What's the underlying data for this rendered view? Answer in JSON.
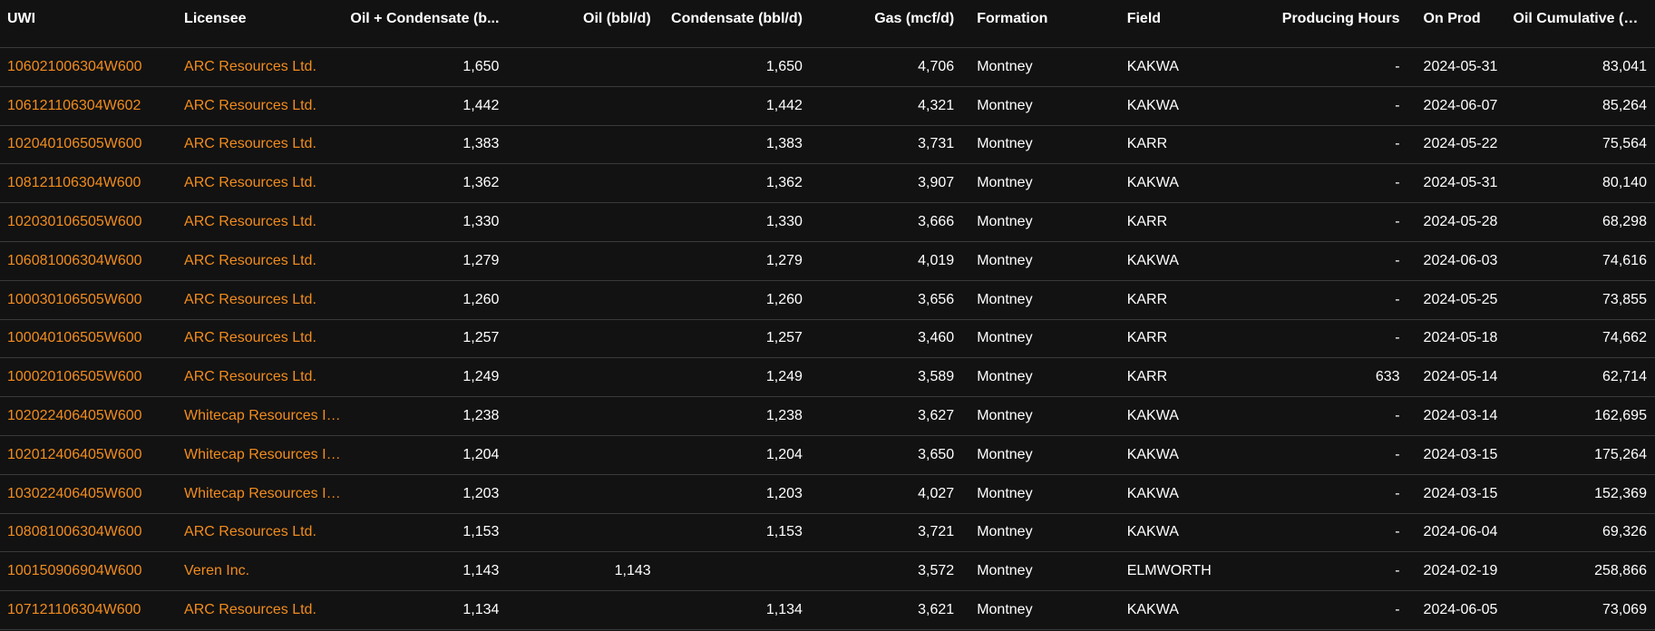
{
  "columns": {
    "uwi": "UWI",
    "licensee": "Licensee",
    "oil_condensate": "Oil + Condensate (b...",
    "oil": "Oil (bbl/d)",
    "condensate": "Condensate (bbl/d)",
    "gas": "Gas (mcf/d)",
    "formation": "Formation",
    "field": "Field",
    "producing_hours": "Producing Hours",
    "on_prod": "On Prod",
    "oil_cumulative": "Oil Cumulative (bbl)"
  },
  "rows": [
    {
      "uwi": "106021006304W600",
      "licensee": "ARC Resources Ltd.",
      "oil_condensate": "1,650",
      "oil": "",
      "condensate": "1,650",
      "gas": "4,706",
      "formation": "Montney",
      "field": "KAKWA",
      "producing_hours": "-",
      "on_prod": "2024-05-31",
      "oil_cumulative": "83,041"
    },
    {
      "uwi": "106121106304W602",
      "licensee": "ARC Resources Ltd.",
      "oil_condensate": "1,442",
      "oil": "",
      "condensate": "1,442",
      "gas": "4,321",
      "formation": "Montney",
      "field": "KAKWA",
      "producing_hours": "-",
      "on_prod": "2024-06-07",
      "oil_cumulative": "85,264"
    },
    {
      "uwi": "102040106505W600",
      "licensee": "ARC Resources Ltd.",
      "oil_condensate": "1,383",
      "oil": "",
      "condensate": "1,383",
      "gas": "3,731",
      "formation": "Montney",
      "field": "KARR",
      "producing_hours": "-",
      "on_prod": "2024-05-22",
      "oil_cumulative": "75,564"
    },
    {
      "uwi": "108121106304W600",
      "licensee": "ARC Resources Ltd.",
      "oil_condensate": "1,362",
      "oil": "",
      "condensate": "1,362",
      "gas": "3,907",
      "formation": "Montney",
      "field": "KAKWA",
      "producing_hours": "-",
      "on_prod": "2024-05-31",
      "oil_cumulative": "80,140"
    },
    {
      "uwi": "102030106505W600",
      "licensee": "ARC Resources Ltd.",
      "oil_condensate": "1,330",
      "oil": "",
      "condensate": "1,330",
      "gas": "3,666",
      "formation": "Montney",
      "field": "KARR",
      "producing_hours": "-",
      "on_prod": "2024-05-28",
      "oil_cumulative": "68,298"
    },
    {
      "uwi": "106081006304W600",
      "licensee": "ARC Resources Ltd.",
      "oil_condensate": "1,279",
      "oil": "",
      "condensate": "1,279",
      "gas": "4,019",
      "formation": "Montney",
      "field": "KAKWA",
      "producing_hours": "-",
      "on_prod": "2024-06-03",
      "oil_cumulative": "74,616"
    },
    {
      "uwi": "100030106505W600",
      "licensee": "ARC Resources Ltd.",
      "oil_condensate": "1,260",
      "oil": "",
      "condensate": "1,260",
      "gas": "3,656",
      "formation": "Montney",
      "field": "KARR",
      "producing_hours": "-",
      "on_prod": "2024-05-25",
      "oil_cumulative": "73,855"
    },
    {
      "uwi": "100040106505W600",
      "licensee": "ARC Resources Ltd.",
      "oil_condensate": "1,257",
      "oil": "",
      "condensate": "1,257",
      "gas": "3,460",
      "formation": "Montney",
      "field": "KARR",
      "producing_hours": "-",
      "on_prod": "2024-05-18",
      "oil_cumulative": "74,662"
    },
    {
      "uwi": "100020106505W600",
      "licensee": "ARC Resources Ltd.",
      "oil_condensate": "1,249",
      "oil": "",
      "condensate": "1,249",
      "gas": "3,589",
      "formation": "Montney",
      "field": "KARR",
      "producing_hours": "633",
      "on_prod": "2024-05-14",
      "oil_cumulative": "62,714"
    },
    {
      "uwi": "102022406405W600",
      "licensee": "Whitecap Resources In...",
      "oil_condensate": "1,238",
      "oil": "",
      "condensate": "1,238",
      "gas": "3,627",
      "formation": "Montney",
      "field": "KAKWA",
      "producing_hours": "-",
      "on_prod": "2024-03-14",
      "oil_cumulative": "162,695"
    },
    {
      "uwi": "102012406405W600",
      "licensee": "Whitecap Resources In...",
      "oil_condensate": "1,204",
      "oil": "",
      "condensate": "1,204",
      "gas": "3,650",
      "formation": "Montney",
      "field": "KAKWA",
      "producing_hours": "-",
      "on_prod": "2024-03-15",
      "oil_cumulative": "175,264"
    },
    {
      "uwi": "103022406405W600",
      "licensee": "Whitecap Resources In...",
      "oil_condensate": "1,203",
      "oil": "",
      "condensate": "1,203",
      "gas": "4,027",
      "formation": "Montney",
      "field": "KAKWA",
      "producing_hours": "-",
      "on_prod": "2024-03-15",
      "oil_cumulative": "152,369"
    },
    {
      "uwi": "108081006304W600",
      "licensee": "ARC Resources Ltd.",
      "oil_condensate": "1,153",
      "oil": "",
      "condensate": "1,153",
      "gas": "3,721",
      "formation": "Montney",
      "field": "KAKWA",
      "producing_hours": "-",
      "on_prod": "2024-06-04",
      "oil_cumulative": "69,326"
    },
    {
      "uwi": "100150906904W600",
      "licensee": "Veren Inc.",
      "oil_condensate": "1,143",
      "oil": "1,143",
      "condensate": "",
      "gas": "3,572",
      "formation": "Montney",
      "field": "ELMWORTH",
      "producing_hours": "-",
      "on_prod": "2024-02-19",
      "oil_cumulative": "258,866"
    },
    {
      "uwi": "107121106304W600",
      "licensee": "ARC Resources Ltd.",
      "oil_condensate": "1,134",
      "oil": "",
      "condensate": "1,134",
      "gas": "3,621",
      "formation": "Montney",
      "field": "KAKWA",
      "producing_hours": "-",
      "on_prod": "2024-06-05",
      "oil_cumulative": "73,069"
    }
  ],
  "colors": {
    "background": "#121212",
    "link": "#f28c1d",
    "text": "#ffffff",
    "divider": "#3a3a3a"
  }
}
